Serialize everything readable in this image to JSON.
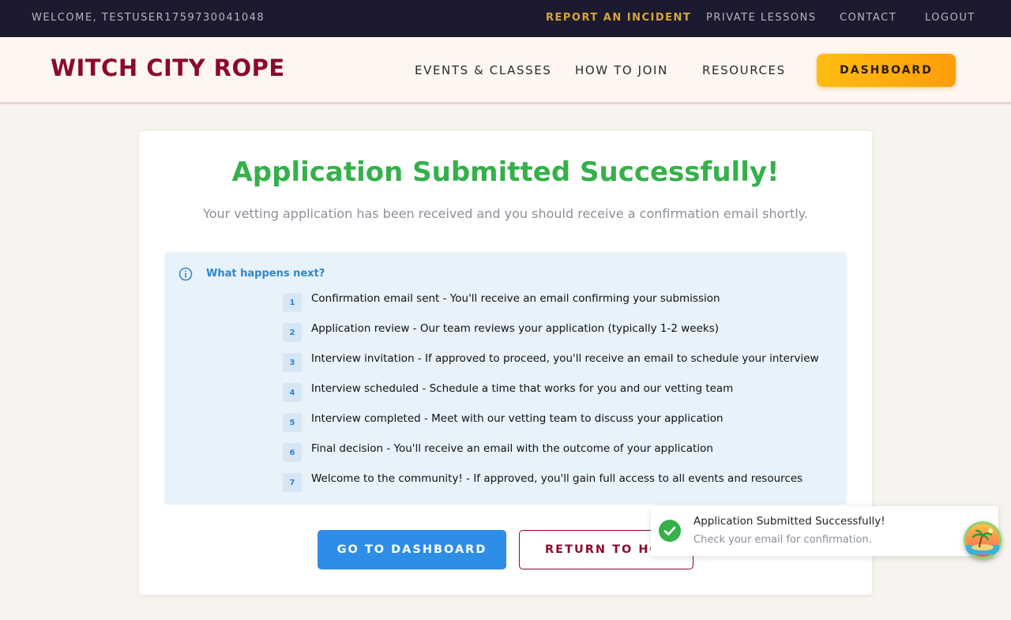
{
  "utility_bar": {
    "welcome": "WELCOME, TESTUSER1759730041048",
    "links": [
      {
        "label": "REPORT AN INCIDENT"
      },
      {
        "label": "PRIVATE LESSONS"
      },
      {
        "label": "CONTACT"
      },
      {
        "label": "LOGOUT"
      }
    ]
  },
  "header": {
    "logo": "WITCH CITY ROPE",
    "nav": [
      {
        "label": "EVENTS & CLASSES"
      },
      {
        "label": "HOW TO JOIN"
      },
      {
        "label": "RESOURCES"
      }
    ],
    "dashboard_label": "DASHBOARD"
  },
  "card": {
    "title": "Application Submitted Successfully!",
    "subtitle": "Your vetting application has been received and you should receive a confirmation email shortly.",
    "info": {
      "heading": "What happens next?",
      "steps": [
        {
          "num": "1",
          "text": "Confirmation email sent - You'll receive an email confirming your submission"
        },
        {
          "num": "2",
          "text": "Application review - Our team reviews your application (typically 1-2 weeks)"
        },
        {
          "num": "3",
          "text": "Interview invitation - If approved to proceed, you'll receive an email to schedule your interview"
        },
        {
          "num": "4",
          "text": "Interview scheduled - Schedule a time that works for you and our vetting team"
        },
        {
          "num": "5",
          "text": "Interview completed - Meet with our vetting team to discuss your application"
        },
        {
          "num": "6",
          "text": "Final decision - You'll receive an email with the outcome of your application"
        },
        {
          "num": "7",
          "text": "Welcome to the community! - If approved, you'll gain full access to all events and resources"
        }
      ]
    },
    "primary_button": "GO TO DASHBOARD",
    "secondary_button": "RETURN TO HOME"
  },
  "toast": {
    "title": "Application Submitted Successfully!",
    "message": "Check your email for confirmation."
  },
  "colors": {
    "brand": "#8a0a2e",
    "success": "#35b04a",
    "accent": "#ffb00f",
    "primary": "#2e8de6"
  }
}
